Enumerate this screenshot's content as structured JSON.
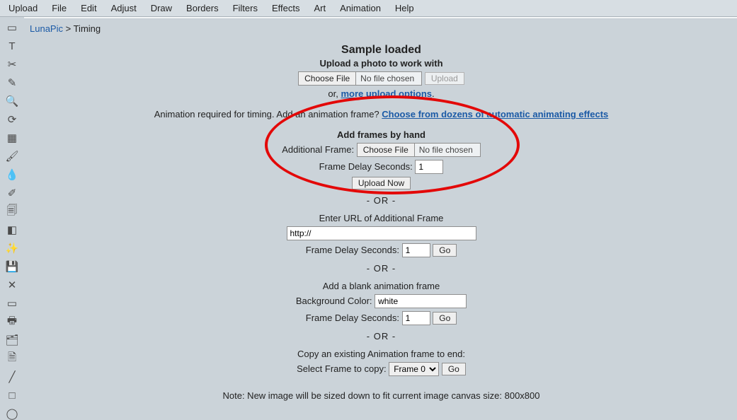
{
  "menu": [
    "Upload",
    "File",
    "Edit",
    "Adjust",
    "Draw",
    "Borders",
    "Filters",
    "Effects",
    "Art",
    "Animation",
    "Help"
  ],
  "breadcrumb": {
    "home": "LunaPic",
    "sep": ">",
    "current": "Timing"
  },
  "title": "Sample loaded",
  "subtitle": "Upload a photo to work with",
  "file": {
    "choose": "Choose File",
    "none": "No file chosen"
  },
  "upload_btn": "Upload",
  "or_upload": {
    "prefix": "or, ",
    "link": "more upload options",
    "suffix": "."
  },
  "anim_notice": {
    "text": "Animation required for timing. Add an animation frame? ",
    "link": "Choose from dozens of automatic animating effects"
  },
  "sec1": {
    "header": "Add frames by hand",
    "label": "Additional Frame:",
    "delay_label": "Frame Delay Seconds:",
    "delay_value": "1",
    "upload_now": "Upload Now"
  },
  "or": "- OR -",
  "sec2": {
    "header": "Enter URL of Additional Frame",
    "url_value": "http://",
    "delay_label": "Frame Delay Seconds:",
    "delay_value": "1",
    "go": "Go"
  },
  "sec3": {
    "header": "Add a blank animation frame",
    "bg_label": "Background Color:",
    "bg_value": "white",
    "delay_label": "Frame Delay Seconds:",
    "delay_value": "1",
    "go": "Go"
  },
  "sec4": {
    "header": "Copy an existing Animation frame to end:",
    "select_label": "Select Frame to copy:",
    "select_value": "Frame 0",
    "go": "Go"
  },
  "note": "Note: New image will be sized down to fit current image canvas size: 800x800",
  "tools": [
    "select-icon",
    "text-icon",
    "cut-icon",
    "pen-icon",
    "zoom-icon",
    "rotate-icon",
    "gradient-icon",
    "paint-icon",
    "eyedropper-icon",
    "brush-icon",
    "copy-icon",
    "eraser-icon",
    "effects-icon",
    "save-icon",
    "delete-icon",
    "page-icon",
    "print-icon",
    "catalog-icon",
    "clipboard-icon",
    "line-icon",
    "square-icon",
    "circle-icon"
  ],
  "tool_glyphs": [
    "▭",
    "T",
    "✂",
    "✎",
    "🔍",
    "⟳",
    "▦",
    "🖌",
    "💧",
    "✐",
    "🗐",
    "◧",
    "✨",
    "💾",
    "✕",
    "▭",
    "🖶",
    "🗂",
    "🗎",
    "╱",
    "□",
    "◯"
  ]
}
